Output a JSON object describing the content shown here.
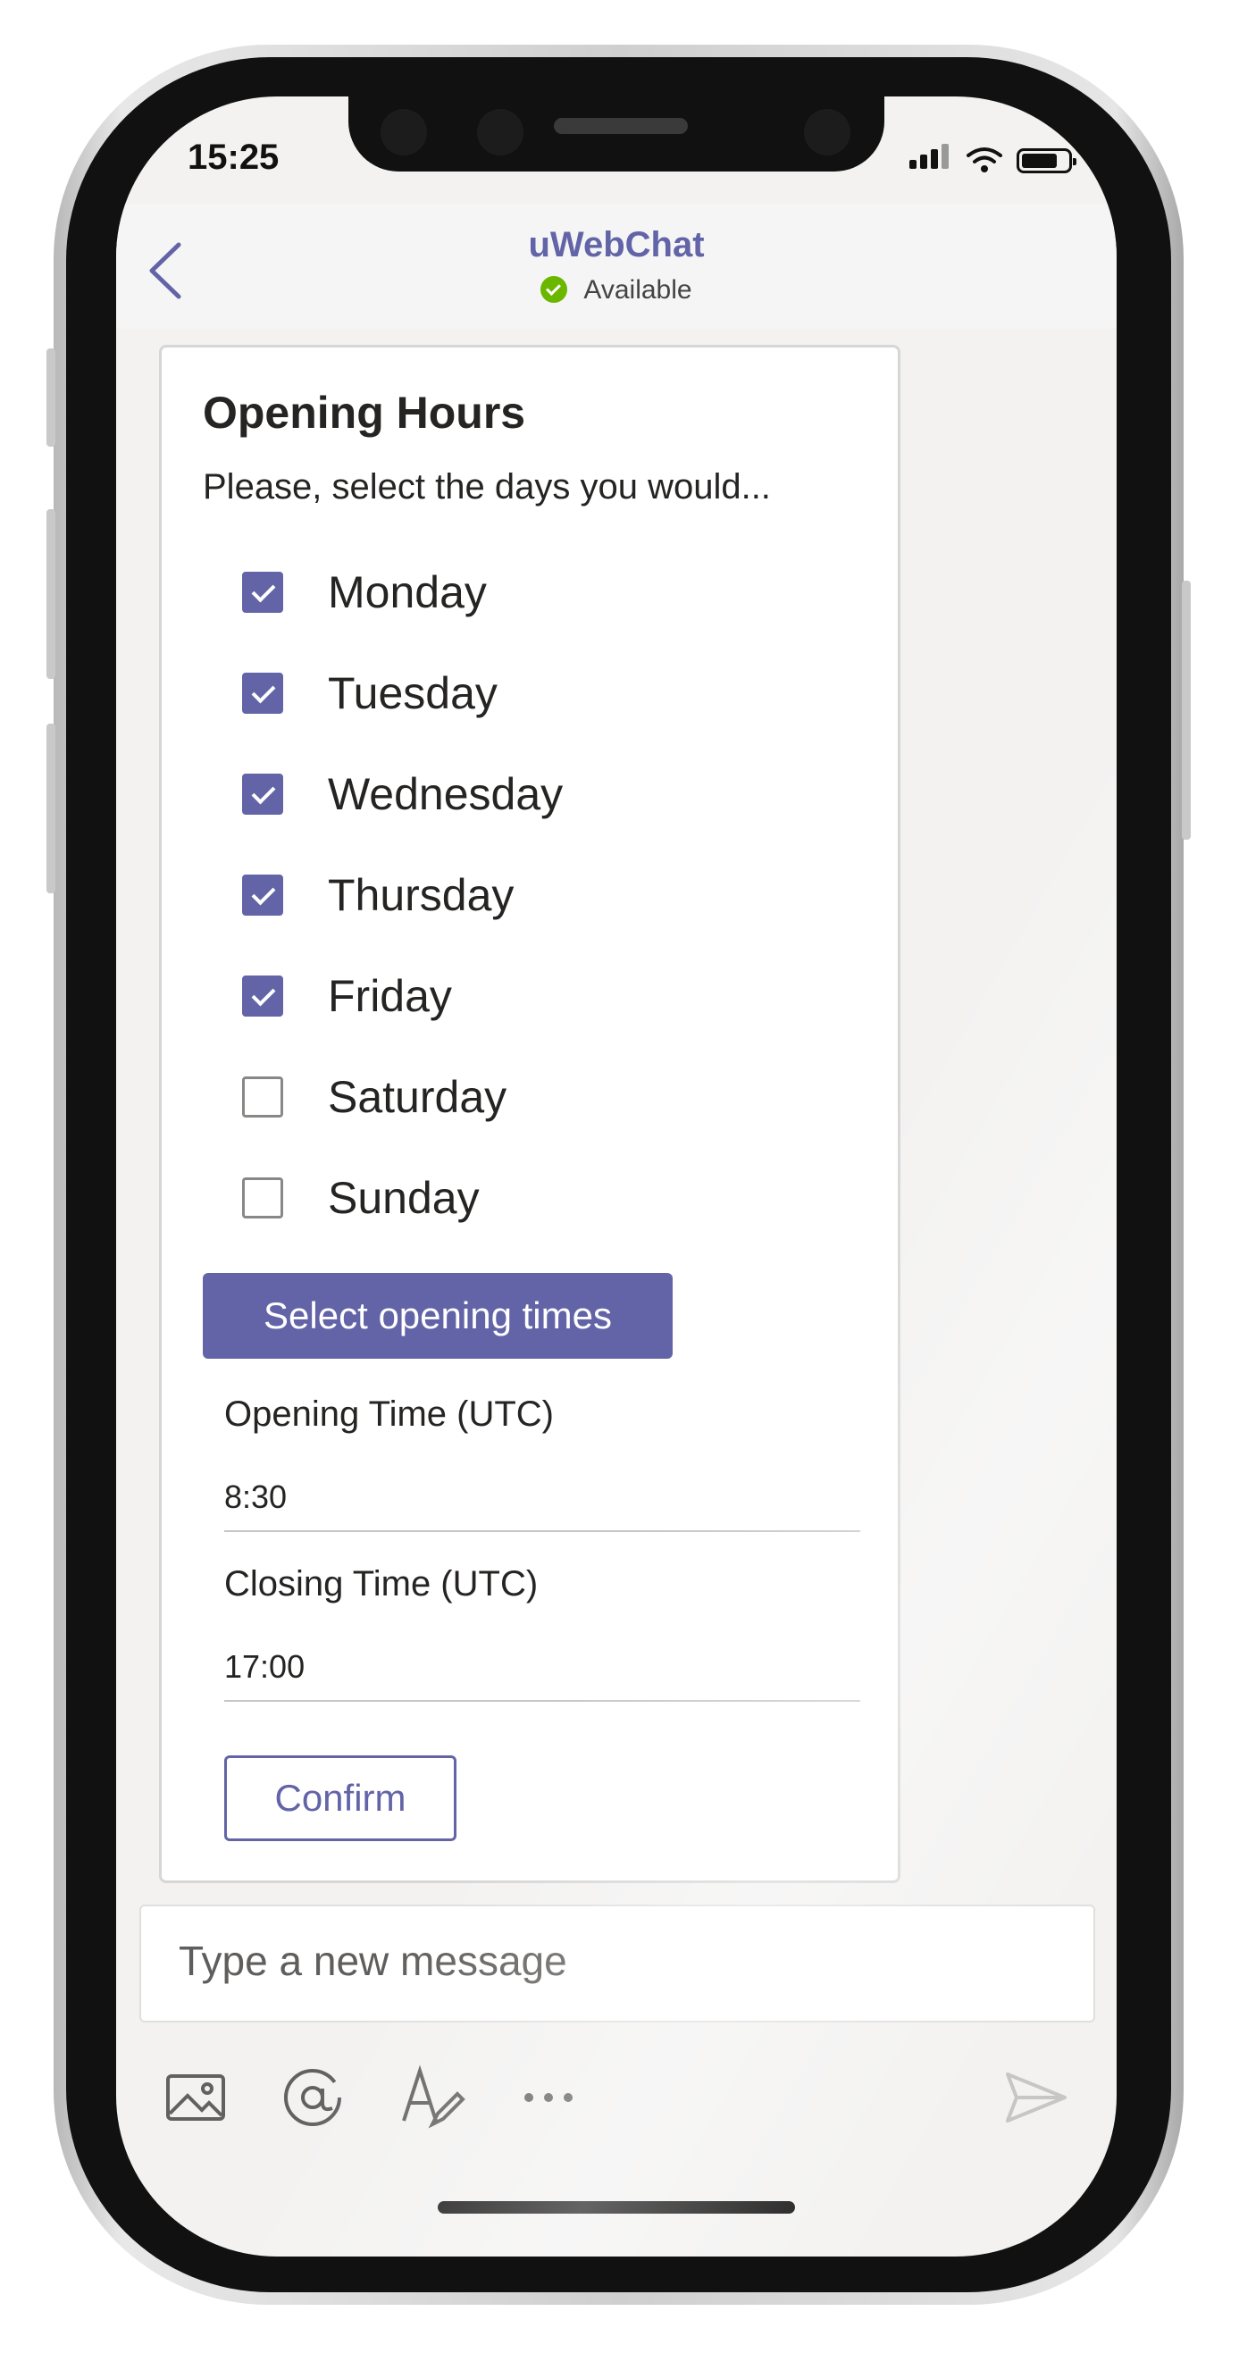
{
  "status_bar": {
    "time": "15:25"
  },
  "header": {
    "title": "uWebChat",
    "presence": "Available"
  },
  "card": {
    "title": "Opening Hours",
    "subtitle": "Please, select the days you would...",
    "days": [
      {
        "label": "Monday",
        "checked": true
      },
      {
        "label": "Tuesday",
        "checked": true
      },
      {
        "label": "Wednesday",
        "checked": true
      },
      {
        "label": "Thursday",
        "checked": true
      },
      {
        "label": "Friday",
        "checked": true
      },
      {
        "label": "Saturday",
        "checked": false
      },
      {
        "label": "Sunday",
        "checked": false
      }
    ],
    "select_times_button": "Select opening times",
    "opening_time": {
      "label": "Opening Time (UTC)",
      "value": "8:30"
    },
    "closing_time": {
      "label": "Closing Time (UTC)",
      "value": "17:00"
    },
    "confirm_button": "Confirm"
  },
  "compose": {
    "placeholder": "Type a new message"
  },
  "colors": {
    "accent": "#6264a7",
    "available": "#6bb700"
  },
  "icons": [
    "back-chevron-icon",
    "image-icon",
    "mention-icon",
    "format-icon",
    "more-icon",
    "send-icon"
  ]
}
